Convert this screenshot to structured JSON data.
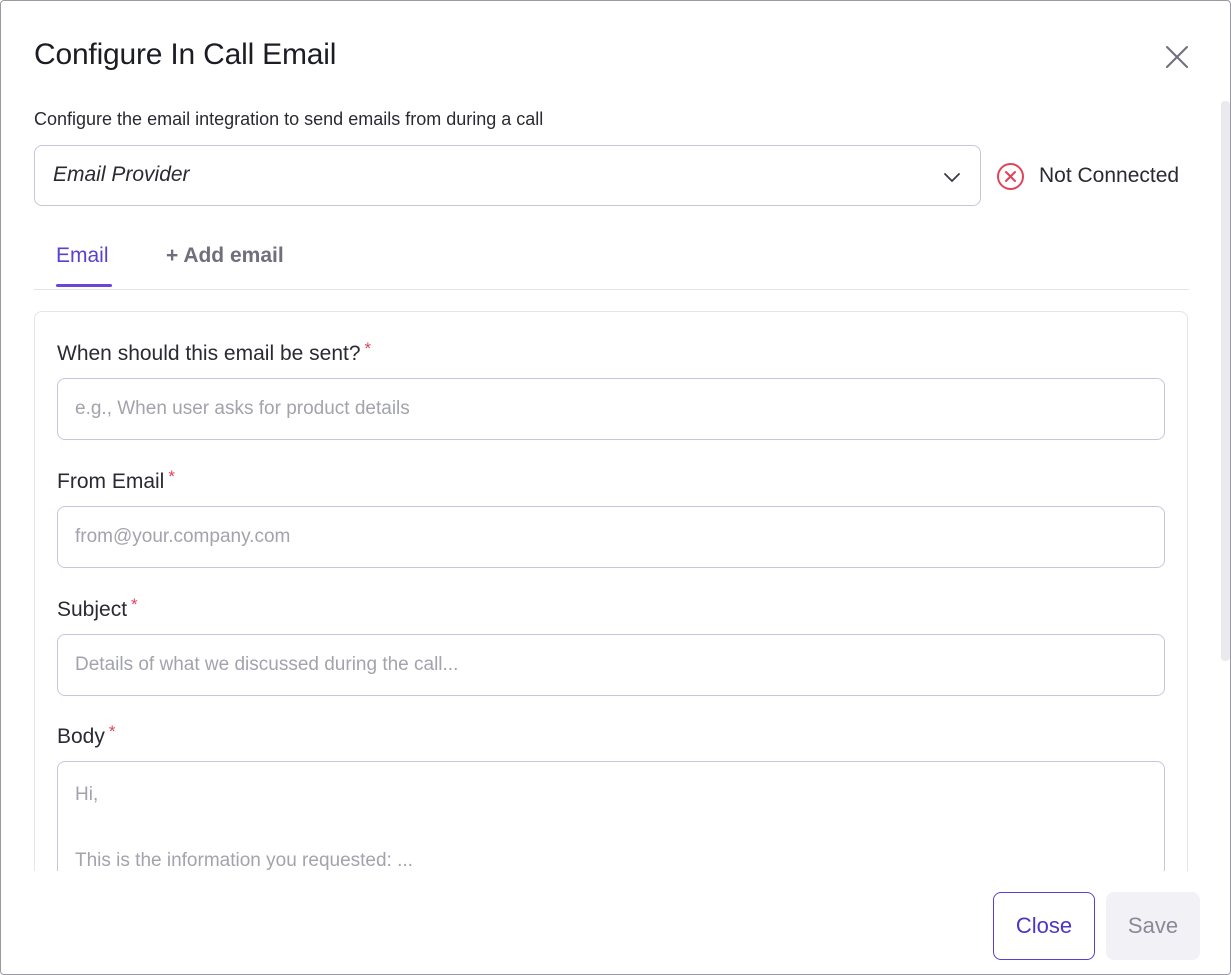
{
  "dialog": {
    "title": "Configure In Call Email",
    "subtitle": "Configure the email integration to send emails from during a call"
  },
  "provider": {
    "selected": "Email Provider",
    "status_text": "Not Connected",
    "status_color": "#e0445a"
  },
  "tabs": [
    {
      "label": "Email",
      "active": true
    },
    {
      "label": "+ Add email",
      "active": false
    }
  ],
  "form": {
    "required_marker": "*",
    "when": {
      "label": "When should this email be sent?",
      "placeholder": "e.g., When user asks for product details"
    },
    "from_email": {
      "label": "From Email",
      "placeholder": "from@your.company.com"
    },
    "subject": {
      "label": "Subject",
      "placeholder": "Details of what we discussed during the call..."
    },
    "body": {
      "label": "Body",
      "placeholder": "Hi,\n\nThis is the information you requested: ..."
    }
  },
  "footer": {
    "close_label": "Close",
    "save_label": "Save"
  },
  "colors": {
    "accent": "#5b3fd0",
    "error": "#e0445a"
  },
  "icons": {
    "close": "close-icon",
    "dropdown": "chevron-down-icon",
    "status": "x-circle-icon"
  }
}
